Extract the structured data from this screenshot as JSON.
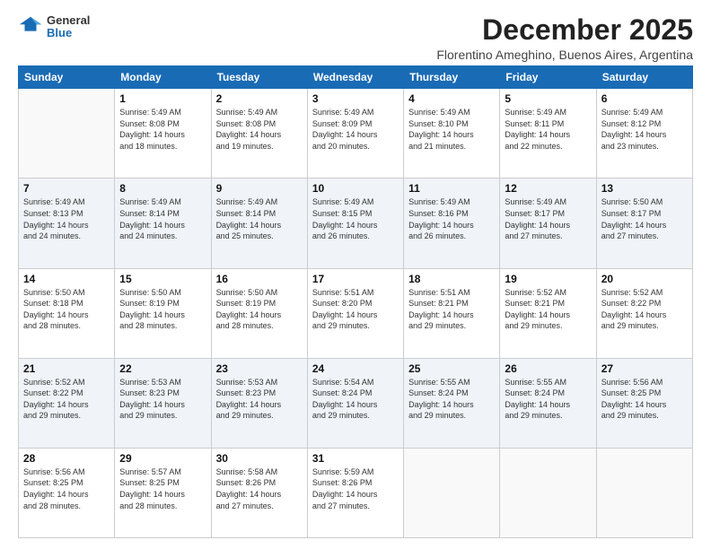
{
  "logo": {
    "line1": "General",
    "line2": "Blue"
  },
  "title": "December 2025",
  "subtitle": "Florentino Ameghino, Buenos Aires, Argentina",
  "days_header": [
    "Sunday",
    "Monday",
    "Tuesday",
    "Wednesday",
    "Thursday",
    "Friday",
    "Saturday"
  ],
  "weeks": [
    [
      {
        "day": "",
        "info": ""
      },
      {
        "day": "1",
        "info": "Sunrise: 5:49 AM\nSunset: 8:08 PM\nDaylight: 14 hours\nand 18 minutes."
      },
      {
        "day": "2",
        "info": "Sunrise: 5:49 AM\nSunset: 8:08 PM\nDaylight: 14 hours\nand 19 minutes."
      },
      {
        "day": "3",
        "info": "Sunrise: 5:49 AM\nSunset: 8:09 PM\nDaylight: 14 hours\nand 20 minutes."
      },
      {
        "day": "4",
        "info": "Sunrise: 5:49 AM\nSunset: 8:10 PM\nDaylight: 14 hours\nand 21 minutes."
      },
      {
        "day": "5",
        "info": "Sunrise: 5:49 AM\nSunset: 8:11 PM\nDaylight: 14 hours\nand 22 minutes."
      },
      {
        "day": "6",
        "info": "Sunrise: 5:49 AM\nSunset: 8:12 PM\nDaylight: 14 hours\nand 23 minutes."
      }
    ],
    [
      {
        "day": "7",
        "info": "Sunrise: 5:49 AM\nSunset: 8:13 PM\nDaylight: 14 hours\nand 24 minutes."
      },
      {
        "day": "8",
        "info": "Sunrise: 5:49 AM\nSunset: 8:14 PM\nDaylight: 14 hours\nand 24 minutes."
      },
      {
        "day": "9",
        "info": "Sunrise: 5:49 AM\nSunset: 8:14 PM\nDaylight: 14 hours\nand 25 minutes."
      },
      {
        "day": "10",
        "info": "Sunrise: 5:49 AM\nSunset: 8:15 PM\nDaylight: 14 hours\nand 26 minutes."
      },
      {
        "day": "11",
        "info": "Sunrise: 5:49 AM\nSunset: 8:16 PM\nDaylight: 14 hours\nand 26 minutes."
      },
      {
        "day": "12",
        "info": "Sunrise: 5:49 AM\nSunset: 8:17 PM\nDaylight: 14 hours\nand 27 minutes."
      },
      {
        "day": "13",
        "info": "Sunrise: 5:50 AM\nSunset: 8:17 PM\nDaylight: 14 hours\nand 27 minutes."
      }
    ],
    [
      {
        "day": "14",
        "info": "Sunrise: 5:50 AM\nSunset: 8:18 PM\nDaylight: 14 hours\nand 28 minutes."
      },
      {
        "day": "15",
        "info": "Sunrise: 5:50 AM\nSunset: 8:19 PM\nDaylight: 14 hours\nand 28 minutes."
      },
      {
        "day": "16",
        "info": "Sunrise: 5:50 AM\nSunset: 8:19 PM\nDaylight: 14 hours\nand 28 minutes."
      },
      {
        "day": "17",
        "info": "Sunrise: 5:51 AM\nSunset: 8:20 PM\nDaylight: 14 hours\nand 29 minutes."
      },
      {
        "day": "18",
        "info": "Sunrise: 5:51 AM\nSunset: 8:21 PM\nDaylight: 14 hours\nand 29 minutes."
      },
      {
        "day": "19",
        "info": "Sunrise: 5:52 AM\nSunset: 8:21 PM\nDaylight: 14 hours\nand 29 minutes."
      },
      {
        "day": "20",
        "info": "Sunrise: 5:52 AM\nSunset: 8:22 PM\nDaylight: 14 hours\nand 29 minutes."
      }
    ],
    [
      {
        "day": "21",
        "info": "Sunrise: 5:52 AM\nSunset: 8:22 PM\nDaylight: 14 hours\nand 29 minutes."
      },
      {
        "day": "22",
        "info": "Sunrise: 5:53 AM\nSunset: 8:23 PM\nDaylight: 14 hours\nand 29 minutes."
      },
      {
        "day": "23",
        "info": "Sunrise: 5:53 AM\nSunset: 8:23 PM\nDaylight: 14 hours\nand 29 minutes."
      },
      {
        "day": "24",
        "info": "Sunrise: 5:54 AM\nSunset: 8:24 PM\nDaylight: 14 hours\nand 29 minutes."
      },
      {
        "day": "25",
        "info": "Sunrise: 5:55 AM\nSunset: 8:24 PM\nDaylight: 14 hours\nand 29 minutes."
      },
      {
        "day": "26",
        "info": "Sunrise: 5:55 AM\nSunset: 8:24 PM\nDaylight: 14 hours\nand 29 minutes."
      },
      {
        "day": "27",
        "info": "Sunrise: 5:56 AM\nSunset: 8:25 PM\nDaylight: 14 hours\nand 29 minutes."
      }
    ],
    [
      {
        "day": "28",
        "info": "Sunrise: 5:56 AM\nSunset: 8:25 PM\nDaylight: 14 hours\nand 28 minutes."
      },
      {
        "day": "29",
        "info": "Sunrise: 5:57 AM\nSunset: 8:25 PM\nDaylight: 14 hours\nand 28 minutes."
      },
      {
        "day": "30",
        "info": "Sunrise: 5:58 AM\nSunset: 8:26 PM\nDaylight: 14 hours\nand 27 minutes."
      },
      {
        "day": "31",
        "info": "Sunrise: 5:59 AM\nSunset: 8:26 PM\nDaylight: 14 hours\nand 27 minutes."
      },
      {
        "day": "",
        "info": ""
      },
      {
        "day": "",
        "info": ""
      },
      {
        "day": "",
        "info": ""
      }
    ]
  ]
}
